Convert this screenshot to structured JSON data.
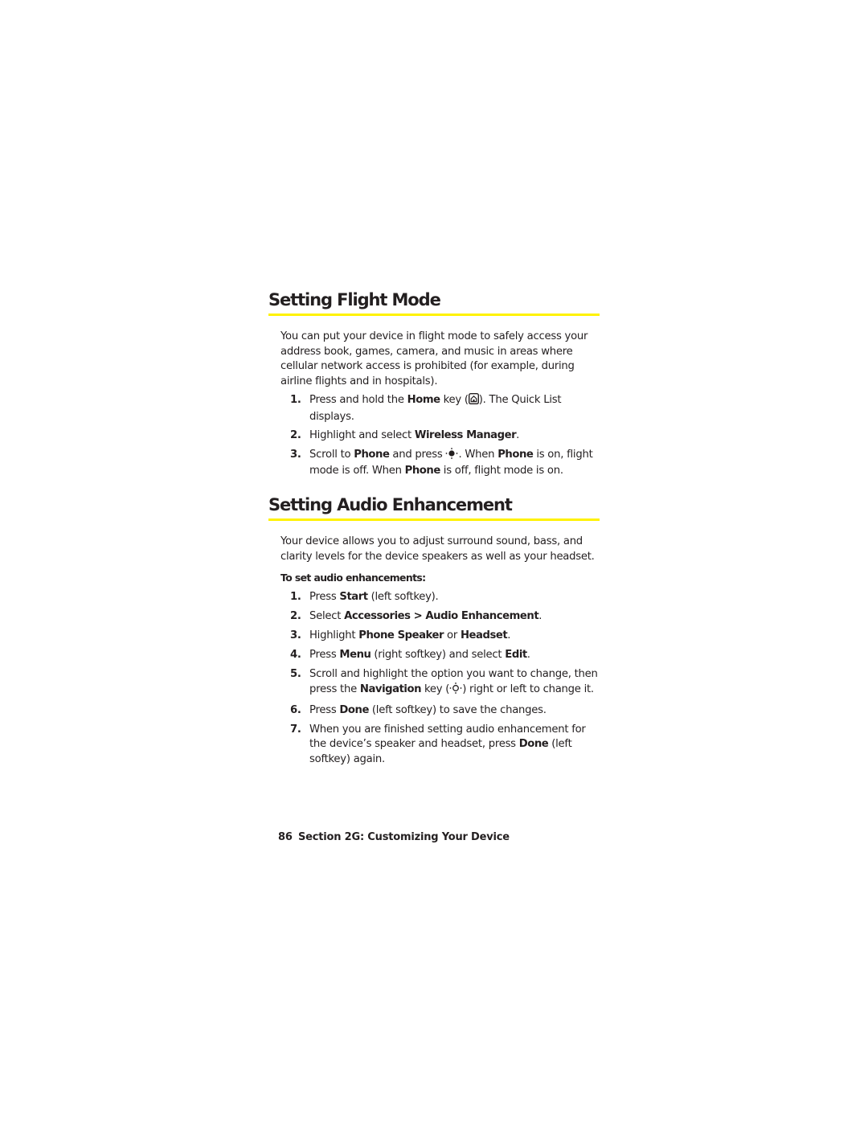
{
  "sections": [
    {
      "title": "Setting Flight Mode",
      "intro": "You can put your device in flight mode to safely access your address book, games, camera, and music in areas where cellular network access is prohibited (for example, during airline flights and in hospitals).",
      "steps": [
        {
          "number": "1.",
          "parts": [
            "Press and hold the ",
            "Home",
            " key (",
            "). The Quick List displays."
          ],
          "icon": "home-key-icon"
        },
        {
          "number": "2.",
          "parts": [
            "Highlight and select ",
            "Wireless Manager",
            "."
          ]
        },
        {
          "number": "3.",
          "parts": [
            "Scroll to ",
            "Phone",
            " and press ",
            ". When ",
            "Phone",
            " is on, flight mode is off. When ",
            "Phone",
            " is off, flight mode is on."
          ],
          "icon": "navigation-select-key-icon"
        }
      ]
    },
    {
      "title": "Setting Audio Enhancement",
      "intro": "Your device allows you to adjust surround sound, bass, and clarity levels for the device speakers as well as your headset.",
      "subhead": "To set audio enhancements:",
      "steps": [
        {
          "number": "1.",
          "parts": [
            "Press ",
            "Start",
            " (left softkey)."
          ]
        },
        {
          "number": "2.",
          "parts": [
            "Select ",
            "Accessories > Audio Enhancement",
            "."
          ]
        },
        {
          "number": "3.",
          "parts": [
            "Highlight ",
            "Phone Speaker",
            " or ",
            "Headset",
            "."
          ]
        },
        {
          "number": "4.",
          "parts": [
            "Press ",
            "Menu",
            " (right softkey) and select ",
            "Edit",
            "."
          ]
        },
        {
          "number": "5.",
          "parts": [
            "Scroll and highlight the option you want to change, then press the ",
            "Navigation",
            " key (",
            ") right or left to change it."
          ],
          "icon": "navigation-key-icon"
        },
        {
          "number": "6.",
          "parts": [
            "Press ",
            "Done",
            " (left softkey) to save the changes."
          ]
        },
        {
          "number": "7.",
          "parts": [
            "When you are finished setting audio enhancement for the device’s speaker and headset, press ",
            "Done",
            " (left softkey) again."
          ]
        }
      ]
    }
  ],
  "footer": {
    "page_number": "86",
    "section_label": "Section 2G: Customizing Your Device"
  },
  "colors": {
    "text": "#231f20",
    "rule": "#fff200"
  }
}
